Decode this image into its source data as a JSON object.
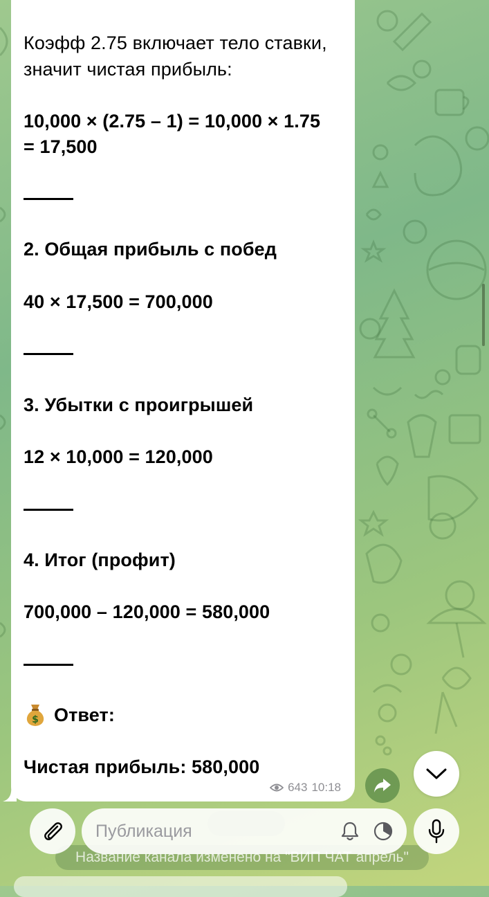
{
  "message": {
    "intro_line1": "Коэфф 2.75 включает тело ставки,",
    "intro_line2": "значит чистая прибыль:",
    "formula1_line1": "10,000 × (2.75 – 1) = 10,000 × 1.75",
    "formula1_line2": "= 17,500",
    "section2_title": "2. Общая прибыль с побед",
    "section2_formula": "40 × 17,500 = 700,000",
    "section3_title": "3. Убытки с проигрышей",
    "section3_formula": "12 × 10,000 = 120,000",
    "section4_title": "4. Итог (профит)",
    "section4_formula": "700,000 – 120,000 = 580,000",
    "answer_label": "Ответ:",
    "answer_text": "Чистая прибыль: 580,000",
    "views": "643",
    "time": "10:18"
  },
  "service_message": "Название канала изменено на \"ВИП ЧАТ апрель\"",
  "input": {
    "placeholder": "Публикация",
    "value": ""
  },
  "icons": {
    "attach": "paperclip-icon",
    "bell": "bell-icon",
    "timer": "timer-icon",
    "mic": "microphone-icon",
    "share": "share-arrow-icon",
    "scroll_down": "chevron-down-icon",
    "views": "eye-icon",
    "answer_emoji": "money-bag-icon"
  },
  "colors": {
    "bubble": "#ffffff",
    "text": "#000000",
    "meta": "#8e8e93",
    "wallpaper_start": "#9fc98e",
    "wallpaper_end": "#c2d57d"
  }
}
